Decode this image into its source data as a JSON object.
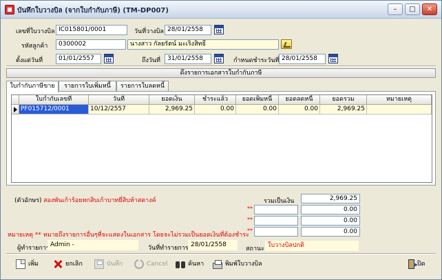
{
  "window": {
    "title": "บันทึกใบวางบิล (จากใบกำกับภาษี) (TM-DP007)",
    "controls": [
      "–",
      "□",
      "✕"
    ]
  },
  "header": {
    "bill_no_label": "เลขที่ใบวางบิล",
    "bill_no": "IC015801/0001",
    "bill_date_label": "วันที่วางบิล",
    "bill_date": "28/01/2558",
    "customer_code_label": "รหัสลูกค้า",
    "customer_code": "0300002",
    "customer_name": "นางสาว กัลยรัตน์ มะเริงสิทธิ์",
    "from_date_label": "ตั้งแต่วันที่",
    "from_date": "01/01/2557",
    "to_date_label": "ถึงวันที่",
    "to_date": "31/01/2558",
    "due_date_label": "กำหนดชำระวันที่",
    "due_date": "28/01/2558"
  },
  "fetch_button": "ดึงรายการเอกสารใบกำกับภาษี",
  "tabs": [
    {
      "label": "ใบกำกับภาษีขาย",
      "active": true
    },
    {
      "label": "รายการใบเพิ่มหนี้",
      "active": false
    },
    {
      "label": "รายการใบลดหนี้",
      "active": false
    }
  ],
  "table": {
    "columns": [
      "ใบกำกับเลขที่",
      "วันที่",
      "ยอดเงิน",
      "ชำระแล้ว",
      "ยอดเพิ่มหนี้",
      "ยอดลดหนี้",
      "ยอดรวม",
      "หมายเหตุ"
    ],
    "rows": [
      [
        "PF015712/0001",
        "10/12/2557",
        "2,969.25",
        "0.00",
        "0.00",
        "0.00",
        "2,969.25",
        ""
      ]
    ]
  },
  "summary": {
    "words_label": "(ตัวอักษร)",
    "words_value": "สองพันเก้าร้อยหกสิบเก้าบาทยี่สิบห้าสตางค์",
    "total_label": "รวมเป็นเงิน",
    "total_value": "2,969.25",
    "extra_marks": [
      "**",
      "**",
      "**"
    ],
    "extra_values": [
      "0.00",
      "0.00",
      "0.00"
    ],
    "remark": "หมายเหตุ ** หมายถึงรายการอื่นๆที่จะแสดงในเอกสาร โดยจะไม่รวมเป็นยอดเงินที่ต้องชำระ",
    "recorder_label": "ผู้ทำรายการ",
    "recorder": "Admin -",
    "record_date_label": "วันที่ทำรายการ",
    "record_date": "28/01/2558",
    "status_label": "สถานะ",
    "status": "ใบวางบิลปกติ"
  },
  "toolbar": {
    "new": "เพิ่ม",
    "cancel_doc": "ยกเลิก",
    "save": "บันทึก",
    "cancel": "Cancel",
    "search": "ค้นหา",
    "print": "พิมพ์ใบวางบิล",
    "exit": "ปิด"
  }
}
